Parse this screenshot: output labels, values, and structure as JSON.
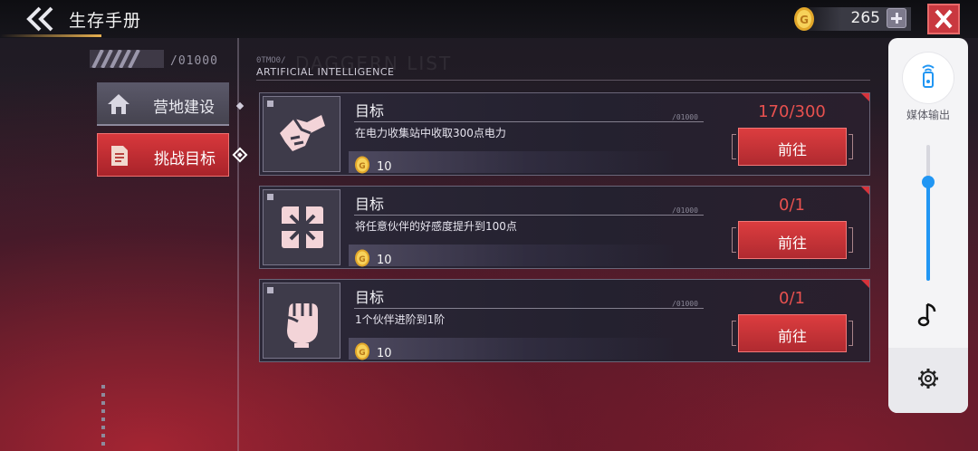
{
  "header": {
    "title": "生存手册",
    "coins": "265"
  },
  "sidebar": {
    "page_code": "/01000",
    "items": [
      {
        "label": "营地建设"
      },
      {
        "label": "挑战目标"
      }
    ]
  },
  "content": {
    "section_code": "0TMO0/",
    "section_title": "ARTIFICIAL INTELLIGENCE",
    "section_ghost": "DAGGERN LIST"
  },
  "tasks": [
    {
      "title": "目标",
      "code": "/01000",
      "desc": "在电力收集站中收取300点电力",
      "reward": "10",
      "progress": "170/300",
      "button": "前往",
      "icon": "handshake-icon"
    },
    {
      "title": "目标",
      "code": "/01000",
      "desc": "将任意伙伴的好感度提升到100点",
      "reward": "10",
      "progress": "0/1",
      "button": "前往",
      "icon": "gift-box-icon"
    },
    {
      "title": "目标",
      "code": "/01000",
      "desc": "1个伙伴进阶到1阶",
      "reward": "10",
      "progress": "0/1",
      "button": "前往",
      "icon": "fist-icon"
    }
  ],
  "media_panel": {
    "output_label": "媒体输出",
    "volume_level": 0.73
  },
  "colors": {
    "accent_red": "#d6333b",
    "progress_red": "#e8514f",
    "media_blue": "#2196f3"
  }
}
